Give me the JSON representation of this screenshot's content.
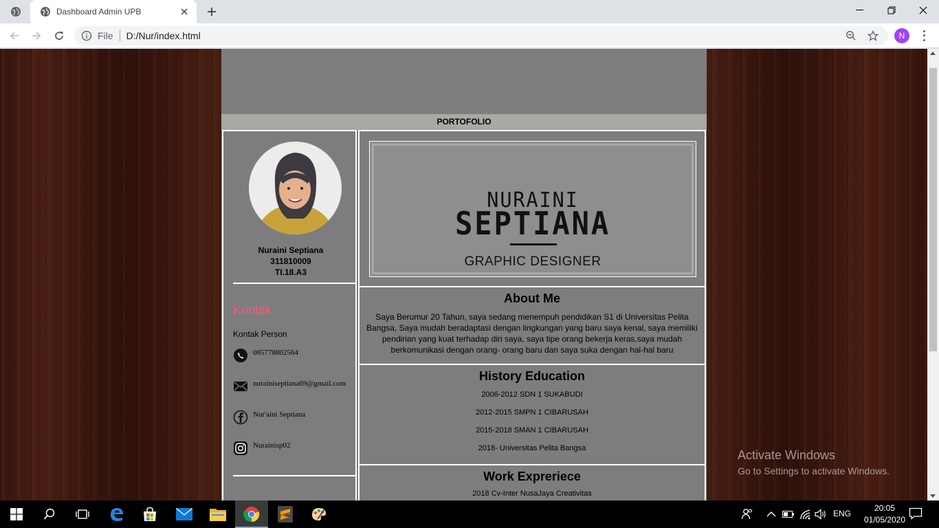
{
  "browser": {
    "tab_title": "Dashboard Admin UPB",
    "omnibox_scheme": "File",
    "url": "D:/Nur/index.html",
    "profile_initial": "N"
  },
  "page": {
    "nav_title": "PORTOFOLIO",
    "profile": {
      "name": "Nuraini Septiana",
      "nim": "311810009",
      "class": "TI.18.A3"
    },
    "contact": {
      "heading": "Kontak",
      "label": "Kontak Person",
      "items": [
        {
          "icon": "whatsapp-icon",
          "text": "085778802564"
        },
        {
          "icon": "email-icon",
          "text": "nurainiseptiana69@gmail.com"
        },
        {
          "icon": "facebook-icon",
          "text": "Nur'aini Septiana"
        },
        {
          "icon": "instagram-icon",
          "text": "Nurainisp02"
        }
      ]
    },
    "logo": {
      "line1": "NURAINI",
      "line2": "SEPTIANA",
      "line3": "GRAPHIC DESIGNER"
    },
    "about": {
      "title": "About Me",
      "body": "Saya Berumur 20 Tahun, saya sedang menempuh pendidikan S1 di Universitas Pelita Bangsa, Saya mudah beradaptasi dengan lingkungan yang baru saya kenal, saya memiliki pendirian yang kuat terhadap diri saya, saya tipe orang bekerja keras,saya mudah berkomunikasi dengan orang- orang baru dan saya suka dengan hal-hal baru"
    },
    "education": {
      "title": "History Education",
      "items": [
        "2006-2012 SDN 1 SUKABUDI",
        "2012-2015 SMPN 1 CIBARUSAH",
        "2015-2018 SMAN 1 CIBARUSAH",
        "2018- Universitas Pelita Bangsa"
      ]
    },
    "work": {
      "title": "Work Expreriece",
      "items": [
        "2018 Cv-Inter NusaJaya Creativitas"
      ]
    }
  },
  "watermark": {
    "line1": "Activate Windows",
    "line2": "Go to Settings to activate Windows."
  },
  "taskbar": {
    "language": "ENG",
    "time": "20:05",
    "date": "01/05/2020"
  },
  "colors": {
    "accent_heading": "#f55a7a",
    "page_bg": "#7d7d7d",
    "nav_bg": "#a9a8a4"
  }
}
